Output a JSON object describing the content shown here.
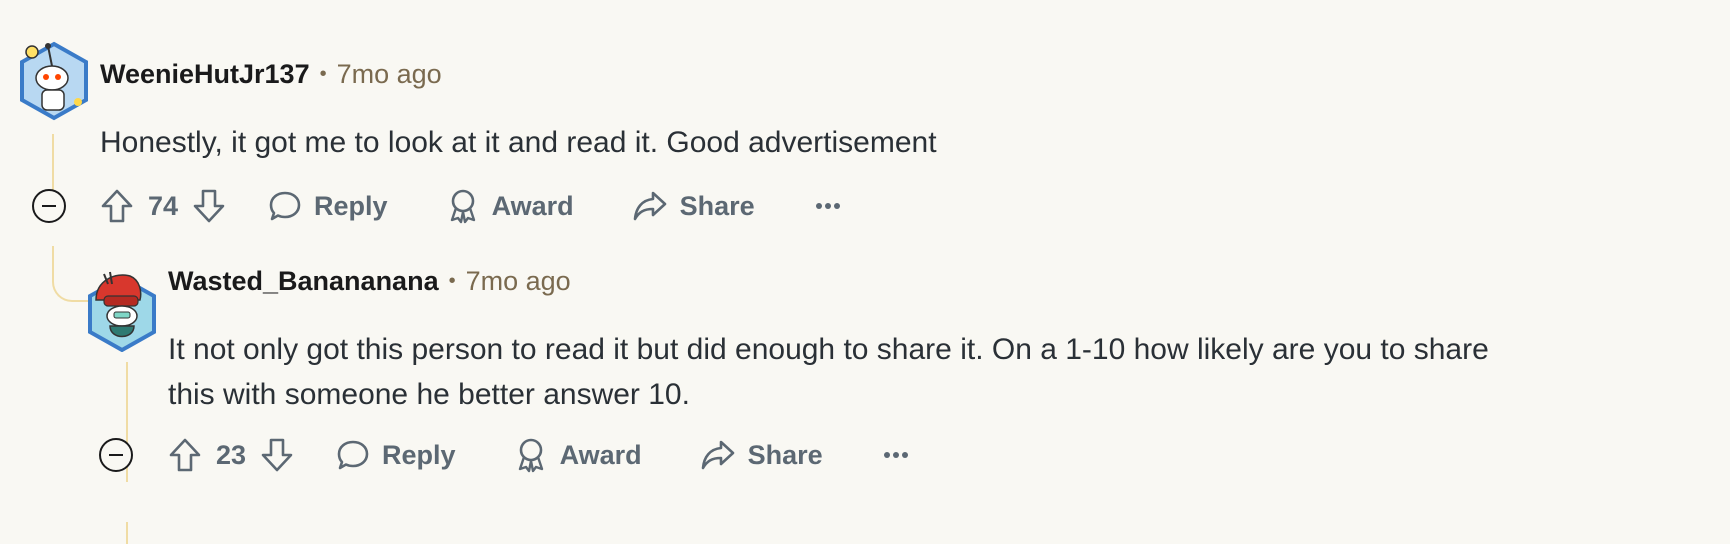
{
  "comments": [
    {
      "username": "WeenieHutJr137",
      "separator": "•",
      "time": "7mo ago",
      "body": "Honestly, it got me to look at it and read it. Good advertisement",
      "score": "74",
      "reply_label": "Reply",
      "award_label": "Award",
      "share_label": "Share"
    },
    {
      "username": "Wasted_Banananana",
      "separator": "•",
      "time": "7mo ago",
      "body_line1": "It not only got this person to read it but did enough to share it. On a 1-10 how likely are you to share",
      "body_line2": "this with someone he better answer 10.",
      "score": "23",
      "reply_label": "Reply",
      "award_label": "Award",
      "share_label": "Share"
    }
  ],
  "colors": {
    "background": "#f9f8f3",
    "thread_line": "#f0dca4",
    "meta_text": "#7a6a4f",
    "action_text": "#5c6873"
  },
  "icons": [
    "avatar-snoo",
    "collapse-icon",
    "upvote-icon",
    "downvote-icon",
    "reply-icon",
    "award-icon",
    "share-icon",
    "more-icon"
  ]
}
